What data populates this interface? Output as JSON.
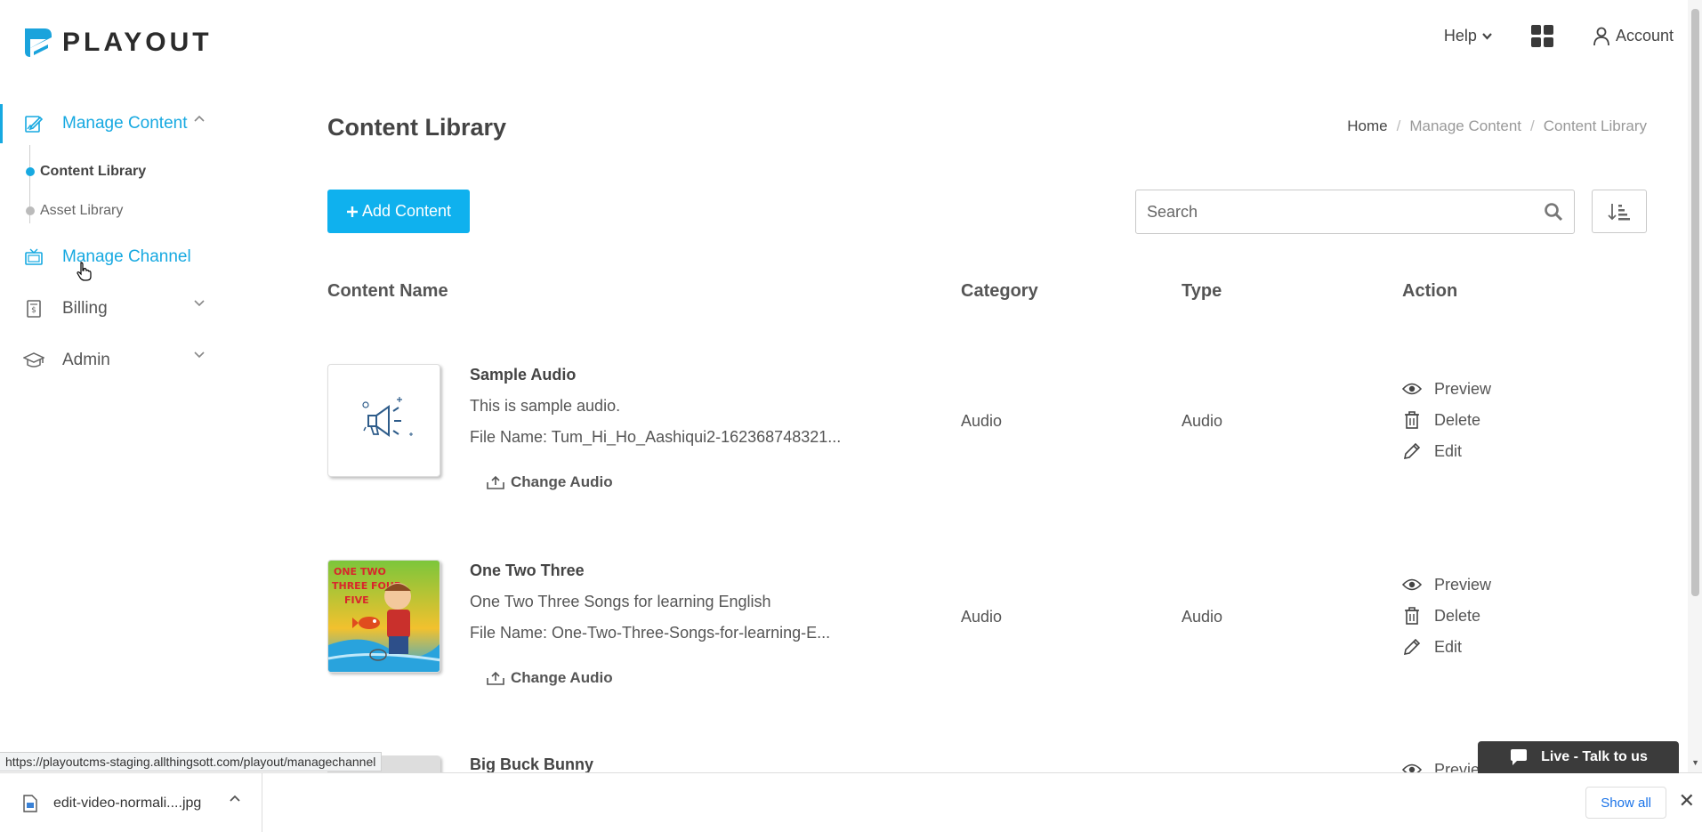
{
  "header": {
    "logo_text": "PLAYOUT",
    "help_label": "Help",
    "account_label": "Account"
  },
  "sidebar": {
    "items": [
      {
        "label": "Manage Content"
      },
      {
        "label": "Manage Channel"
      },
      {
        "label": "Billing"
      },
      {
        "label": "Admin"
      }
    ],
    "sub_items": [
      {
        "label": "Content Library"
      },
      {
        "label": "Asset Library"
      }
    ]
  },
  "main": {
    "title": "Content Library",
    "breadcrumb": {
      "home": "Home",
      "sep1": "/",
      "middle": "Manage Content",
      "sep2": "/",
      "current": "Content Library"
    },
    "add_button_label": "Add Content",
    "search_placeholder": "Search",
    "columns": {
      "name": "Content Name",
      "category": "Category",
      "type": "Type",
      "action": "Action"
    },
    "rows": [
      {
        "name": "Sample Audio",
        "description": "This is sample audio.",
        "file": "File Name: Tum_Hi_Ho_Aashiqui2-162368748321...",
        "change_label": "Change Audio",
        "category": "Audio",
        "type": "Audio"
      },
      {
        "name": "One Two Three",
        "description": "One Two Three Songs for learning English",
        "file": "File Name: One-Two-Three-Songs-for-learning-E...",
        "change_label": "Change Audio",
        "category": "Audio",
        "type": "Audio"
      },
      {
        "name": "Big Buck Bunny"
      }
    ],
    "actions": {
      "preview": "Preview",
      "delete": "Delete",
      "edit": "Edit",
      "preview_partial": "Previe"
    }
  },
  "status_url": "https://playoutcms-staging.allthingsott.com/playout/managechannel",
  "live_chat_label": "Live - Talk to us",
  "download_bar": {
    "file_name": "edit-video-normali....jpg",
    "show_all_label": "Show all"
  },
  "colors": {
    "accent": "#17a9e1",
    "button": "#0fb1ee",
    "chat": "#3b3b3b"
  }
}
